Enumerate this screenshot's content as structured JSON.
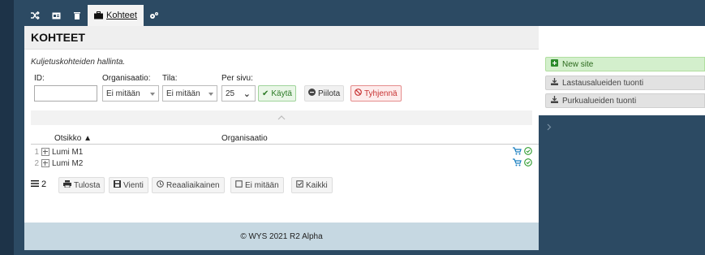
{
  "tabs": [
    {
      "icon": "shuffle-icon"
    },
    {
      "icon": "id-card-icon"
    },
    {
      "icon": "trash-icon"
    },
    {
      "icon": "briefcase-icon",
      "label": "Kohteet"
    },
    {
      "icon": "cogs-icon"
    }
  ],
  "page": {
    "title": "KOHTEET",
    "description": "Kuljetuskohteiden hallinta."
  },
  "filters": {
    "id_label": "ID:",
    "id_value": "",
    "org_label": "Organisaatio:",
    "org_value": "Ei mitään",
    "tila_label": "Tila:",
    "tila_value": "Ei mitään",
    "per_label": "Per sivu:",
    "per_value": "25",
    "apply_label": "Käytä",
    "hide_label": "Piilota",
    "clear_label": "Tyhjennä"
  },
  "table": {
    "columns": [
      "Otsikko ▲",
      "Organisaatio"
    ],
    "rows": [
      {
        "num": "1",
        "title": "Lumi M1",
        "org": ""
      },
      {
        "num": "2",
        "title": "Lumi M2",
        "org": ""
      }
    ]
  },
  "toolbar": {
    "count": "2",
    "print_label": "Tulosta",
    "export_label": "Vienti",
    "realtime_label": "Reaaliaikainen",
    "none_label": "Ei mitään",
    "all_label": "Kaikki"
  },
  "footer": {
    "text": "© WYS 2021 R2 Alpha"
  },
  "side": {
    "new_site": "New site",
    "import_loading": "Lastausalueiden tuonti",
    "import_unloading": "Purkualueiden tuonti"
  },
  "colors": {
    "background": "#2c4a63",
    "accent_green": "#2b7a25",
    "danger": "#c83434",
    "footer": "#c6d8e2"
  }
}
